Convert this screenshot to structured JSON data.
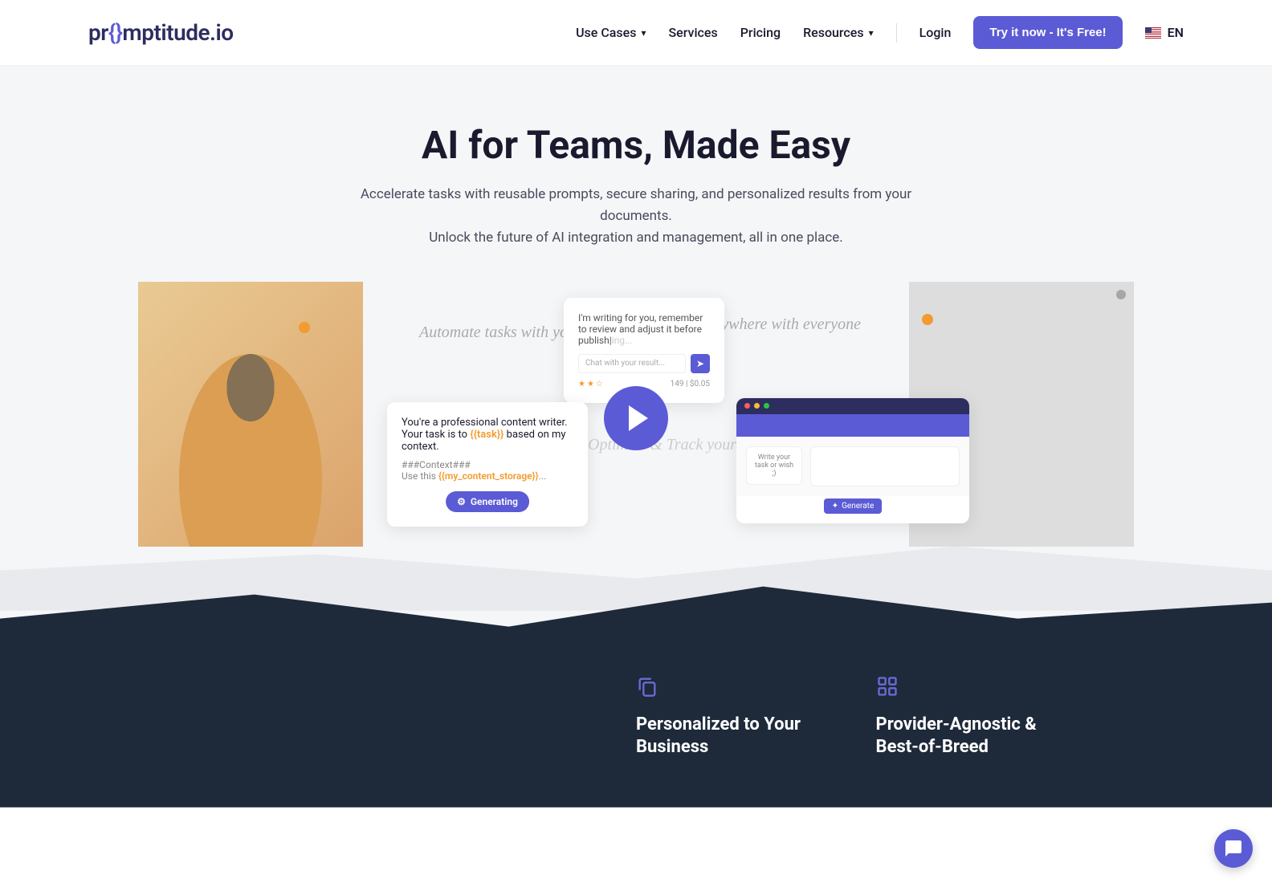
{
  "header": {
    "logo_pre": "pr",
    "logo_brackets": "{}",
    "logo_post": "mptitude.io",
    "nav": {
      "use_cases": "Use Cases",
      "services": "Services",
      "pricing": "Pricing",
      "resources": "Resources",
      "login": "Login"
    },
    "cta": "Try it now - It's Free!",
    "lang": "EN"
  },
  "hero": {
    "title": "AI for Teams, Made Easy",
    "subtitle_line1": "Accelerate tasks with reusable prompts, secure sharing, and personalized results from your documents.",
    "subtitle_line2": "Unlock the future of AI integration and management, all in one place."
  },
  "illustration": {
    "handwritten1": "Automate tasks with your Content",
    "handwritten2": "Share anywhere with everyone",
    "handwritten3": "Optimize & Track your Results",
    "card_middle": {
      "text_pre": "You're a professional content writer. Your task is to ",
      "var1": "{{task}}",
      "text_mid": " based on my context.",
      "context_label": "###Context###",
      "context_text": "Use this ",
      "var2": "{{my_content_storage}}",
      "ellipsis": "...",
      "generating": "Generating"
    },
    "card_top": {
      "text": "I'm writing for you, remember to review and adjust it before publish",
      "cursor": "|",
      "suffix": "ing...",
      "placeholder": "Chat with your result...",
      "stars": "★★☆",
      "stats": "149 | $0.05"
    },
    "card_browser": {
      "task_label": "Write your task or wish ;)",
      "generate": "Generate"
    }
  },
  "features": {
    "f1_title": "Personalized to Your Business",
    "f2_title": "Provider-Agnostic & Best-of-Breed"
  }
}
